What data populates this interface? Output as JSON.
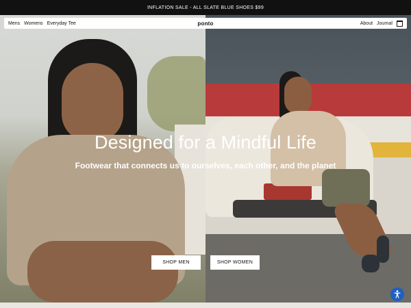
{
  "promo": {
    "text": "INFLATION SALE - ALL SLATE BLUE SHOES $99"
  },
  "nav": {
    "left": [
      "Mens",
      "Womens",
      "Everyday Tee"
    ],
    "logo": "ponto",
    "right": [
      "About",
      "Journal"
    ]
  },
  "hero": {
    "headline": "Designed for a Mindful Life",
    "subhead": "Footwear that connects us to ourselves, each other, and the planet"
  },
  "buttons": {
    "men": "SHOP MEN",
    "women": "SHOP WOMEN"
  },
  "icons": {
    "cart": "shopping-bag-icon",
    "accessibility": "accessibility-icon"
  },
  "colors": {
    "promo_bg": "#111111",
    "accent_accessibility": "#1f5fc2"
  }
}
